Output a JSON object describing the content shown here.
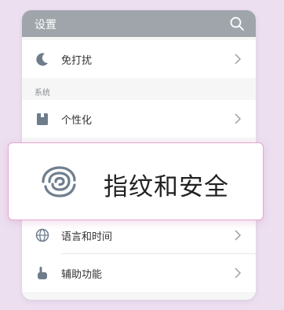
{
  "header": {
    "title": "设置"
  },
  "rows": {
    "dnd": "免打扰",
    "personalize": "个性化",
    "language": "语言和时间",
    "accessibility": "辅助功能"
  },
  "section": {
    "system": "系统"
  },
  "highlight": {
    "label": "指纹和安全"
  },
  "icons": {
    "search": "search-icon",
    "moon": "moon-icon",
    "personalize": "personalize-icon",
    "fingerprint": "fingerprint-icon",
    "globe": "globe-icon",
    "hand": "hand-icon",
    "chevron": "chevron-right-icon"
  },
  "colors": {
    "background": "#ecdff0",
    "header": "#9fa5aa",
    "highlight_border": "#e7a6cf"
  }
}
